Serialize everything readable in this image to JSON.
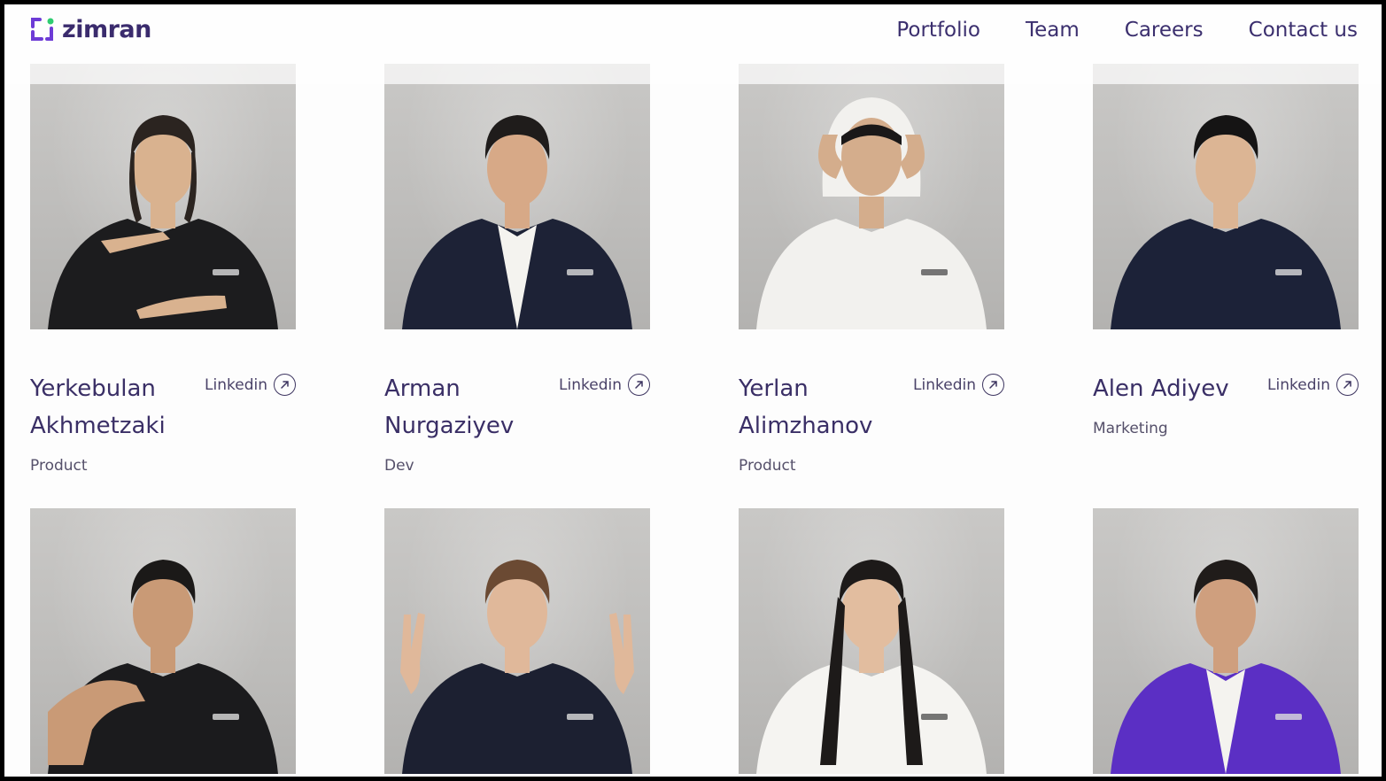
{
  "brand": {
    "name": "zimran",
    "accent": "#6d3bd6",
    "accent2": "#2ecc71",
    "text_color": "#3a2b6d"
  },
  "nav": [
    {
      "label": "Portfolio"
    },
    {
      "label": "Team"
    },
    {
      "label": "Careers"
    },
    {
      "label": "Contact us"
    }
  ],
  "team": [
    {
      "name": "Yerkebulan Akhmetzaki",
      "role": "Product",
      "link_label": "Linkedin",
      "outfit": "#1c1c1e",
      "pose": "gesture"
    },
    {
      "name": "Arman Nurgaziyev",
      "role": "Dev",
      "link_label": "Linkedin",
      "outfit": "#1d2236",
      "pose": "jacket"
    },
    {
      "name": "Yerlan Alimzhanov",
      "role": "Product",
      "link_label": "Linkedin",
      "outfit": "#f2f1ee",
      "pose": "hood"
    },
    {
      "name": "Alen Adiyev",
      "role": "Marketing",
      "link_label": "Linkedin",
      "outfit": "#1c2238",
      "pose": "sweater"
    },
    {
      "name": "",
      "role": "",
      "link_label": "",
      "outfit": "#1b1b1d",
      "pose": "wave"
    },
    {
      "name": "",
      "role": "",
      "link_label": "",
      "outfit": "#1c2031",
      "pose": "peace"
    },
    {
      "name": "",
      "role": "",
      "link_label": "",
      "outfit": "#f5f4f1",
      "pose": "plain"
    },
    {
      "name": "",
      "role": "",
      "link_label": "",
      "outfit": "#5b2fc4",
      "pose": "jacket"
    }
  ]
}
